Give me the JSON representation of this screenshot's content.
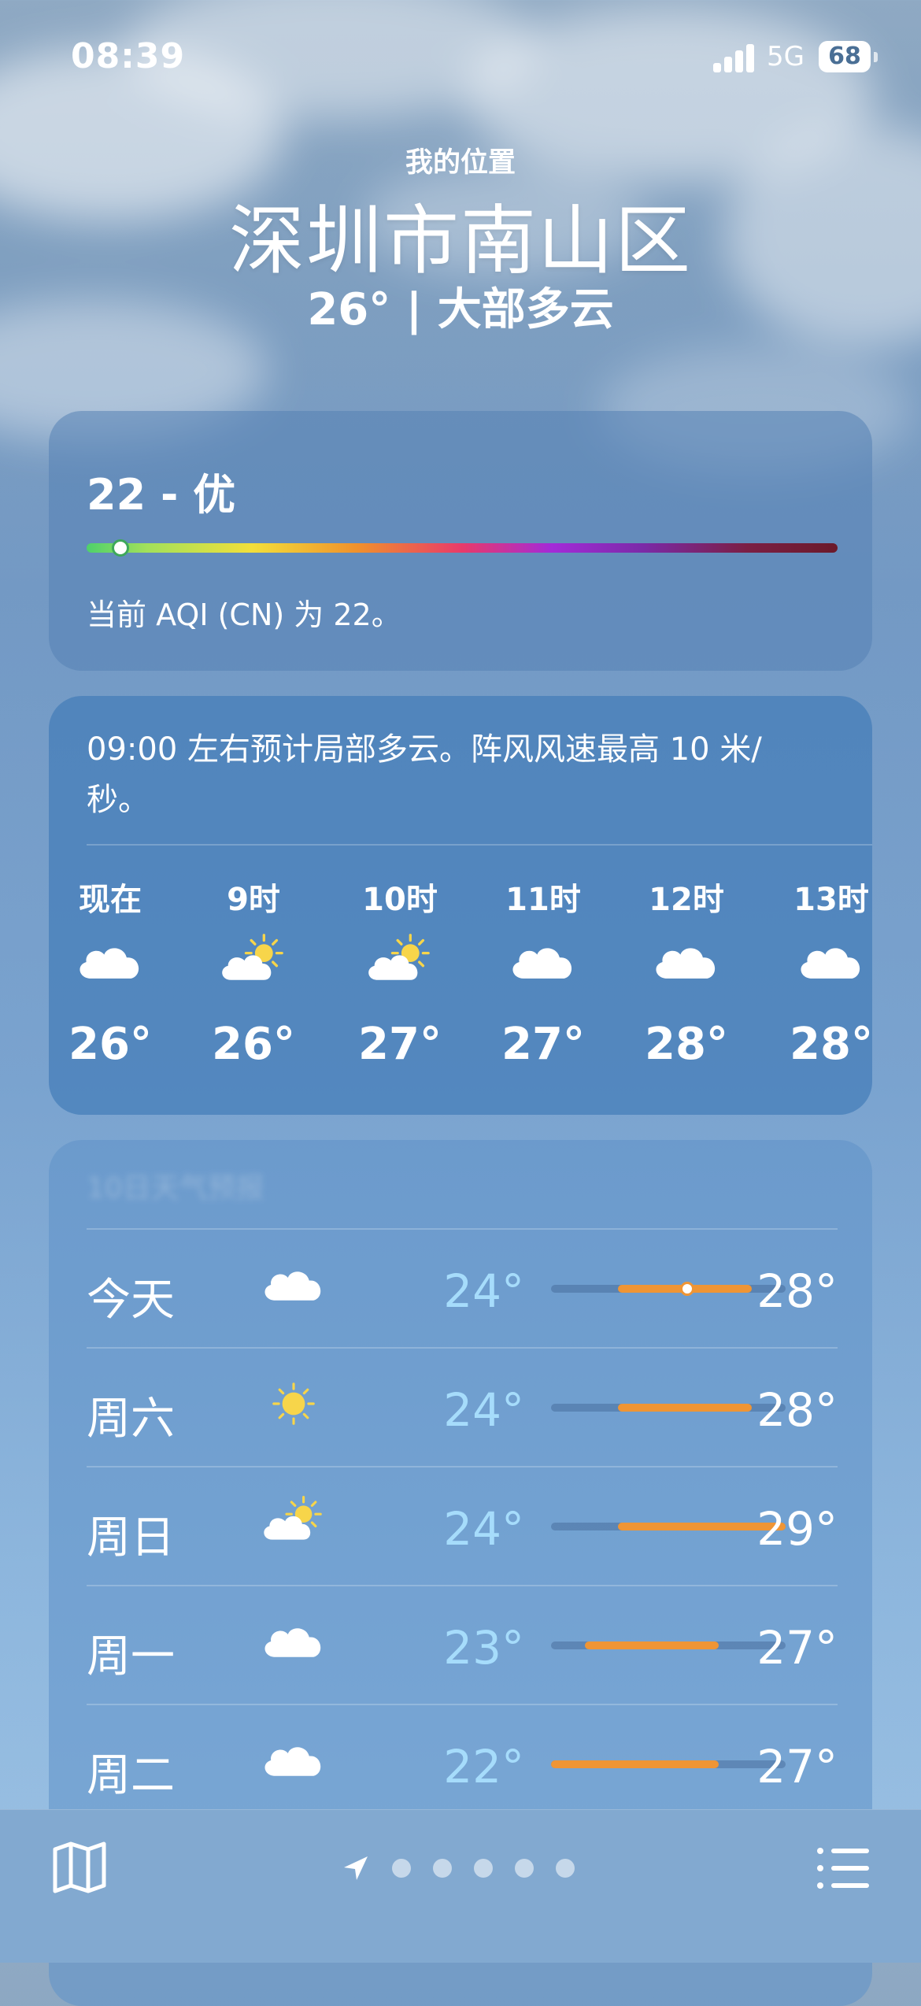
{
  "status": {
    "time": "08:39",
    "network": "5G",
    "battery": "68"
  },
  "header": {
    "location_label": "我的位置",
    "city": "深圳市南山区",
    "condition": "26° | 大部多云"
  },
  "aqi": {
    "value": "22 - 优",
    "level": 0.045,
    "description": "当前 AQI (CN) 为 22。"
  },
  "hourly": {
    "summary": "09:00 左右预计局部多云。阵风风速最高 10 米/秒。",
    "hours": [
      {
        "label": "现在",
        "icon": "cloud-icon",
        "temp": "26°"
      },
      {
        "label": "9时",
        "icon": "partly-sunny-icon",
        "temp": "26°"
      },
      {
        "label": "10时",
        "icon": "partly-sunny-icon",
        "temp": "27°"
      },
      {
        "label": "11时",
        "icon": "cloud-icon",
        "temp": "27°"
      },
      {
        "label": "12时",
        "icon": "cloud-icon",
        "temp": "28°"
      },
      {
        "label": "13时",
        "icon": "cloud-icon",
        "temp": "28°"
      }
    ]
  },
  "daily": {
    "title": "10日天气预报",
    "scale": [
      22,
      29
    ],
    "current": 26,
    "days": [
      {
        "name": "今天",
        "icon": "cloud-icon",
        "low": "24°",
        "high": "28°",
        "low_v": 24,
        "high_v": 28
      },
      {
        "name": "周六",
        "icon": "sun-icon",
        "low": "24°",
        "high": "28°",
        "low_v": 24,
        "high_v": 28
      },
      {
        "name": "周日",
        "icon": "partly-sunny-icon",
        "low": "24°",
        "high": "29°",
        "low_v": 24,
        "high_v": 29
      },
      {
        "name": "周一",
        "icon": "cloud-icon",
        "low": "23°",
        "high": "27°",
        "low_v": 23,
        "high_v": 27
      },
      {
        "name": "周二",
        "icon": "cloud-icon",
        "low": "22°",
        "high": "27°",
        "low_v": 22,
        "high_v": 27
      }
    ]
  },
  "bottom": {
    "page_count": 5,
    "active_page": 0
  },
  "colors": {
    "range_fill": "#ef9535",
    "low_temp": "#a6dcfb"
  }
}
